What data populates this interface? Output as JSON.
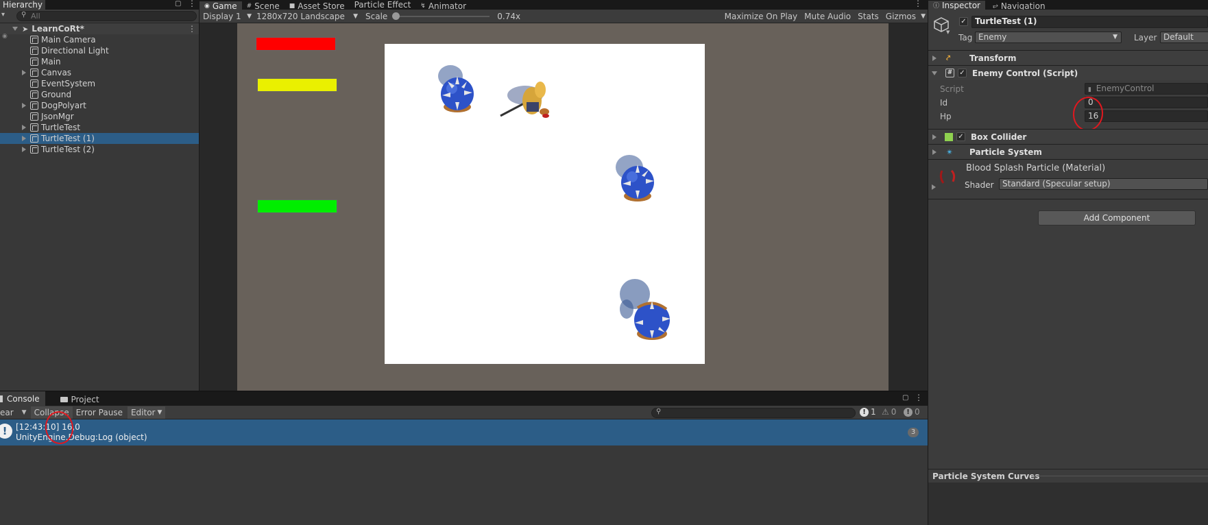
{
  "hierarchy": {
    "tab_label": "Hierarchy",
    "search_placeholder": "All",
    "scene_name": "LearnCoRt*",
    "items": [
      {
        "label": "Main Camera",
        "arrow": false
      },
      {
        "label": "Directional Light",
        "arrow": false
      },
      {
        "label": "Main",
        "arrow": false
      },
      {
        "label": "Canvas",
        "arrow": true
      },
      {
        "label": "EventSystem",
        "arrow": false
      },
      {
        "label": "Ground",
        "arrow": false
      },
      {
        "label": "DogPolyart",
        "arrow": true
      },
      {
        "label": "JsonMgr",
        "arrow": false
      },
      {
        "label": "TurtleTest",
        "arrow": true
      },
      {
        "label": "TurtleTest (1)",
        "arrow": true,
        "selected": true
      },
      {
        "label": "TurtleTest (2)",
        "arrow": true
      }
    ]
  },
  "center_tabs": [
    "Game",
    "Scene",
    "Asset Store",
    "Particle Effect",
    "Animator"
  ],
  "game_toolbar": {
    "display": "Display 1",
    "resolution": "1280x720 Landscape",
    "scale_label": "Scale",
    "scale_value": "0.74x",
    "maximize": "Maximize On Play",
    "mute": "Mute Audio",
    "stats": "Stats",
    "gizmos": "Gizmos"
  },
  "health_bars": [
    {
      "color": "#ff0000"
    },
    {
      "color": "#eaf000"
    },
    {
      "color": "#00ee00"
    }
  ],
  "console": {
    "tabs": [
      "Console",
      "Project"
    ],
    "clear": "ear",
    "collapse": "Collapse",
    "error_pause": "Error Pause",
    "editor": "Editor",
    "counts": {
      "errors": "1",
      "warnings": "0",
      "messages": "0"
    },
    "log": {
      "line1": "[12:43:10] 16,0",
      "line2": "UnityEngine.Debug:Log (object)",
      "count": "3"
    }
  },
  "inspector": {
    "tabs": [
      "Inspector",
      "Navigation"
    ],
    "object_name": "TurtleTest (1)",
    "tag_label": "Tag",
    "tag_value": "Enemy",
    "layer_label": "Layer",
    "layer_value": "Default",
    "components": {
      "transform": "Transform",
      "enemy_control": "Enemy Control (Script)",
      "box_collider": "Box Collider",
      "particle_system": "Particle System"
    },
    "script_label": "Script",
    "script_value": "EnemyControl",
    "id_label": "Id",
    "id_value": "0",
    "hp_label": "Hp",
    "hp_value": "16",
    "material_name": "Blood Splash Particle (Material)",
    "shader_label": "Shader",
    "shader_value": "Standard (Specular setup)",
    "add_component": "Add Component",
    "curves_label": "Particle System Curves"
  },
  "colors": {
    "selection": "#2c5d87",
    "annotation": "#e0181f",
    "game_bg": "#68615a"
  }
}
